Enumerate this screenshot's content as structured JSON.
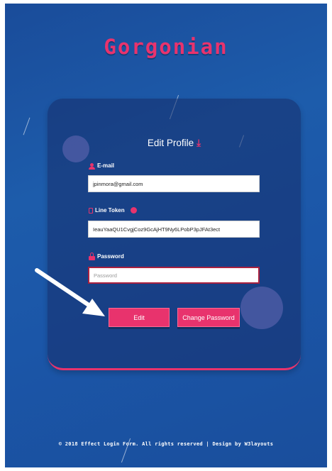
{
  "brand": {
    "title": "Gorgonian"
  },
  "form": {
    "title": "Edit Profile",
    "email": {
      "label": "E-mail",
      "value": "jpinmora@gmail.com"
    },
    "line_token": {
      "label": "Line Token",
      "value": "IeauYaaQU1CvgjCoz9GcAjHT9Ny6LPobP3pJFAt3ect"
    },
    "password": {
      "label": "Password",
      "value": "",
      "placeholder": "Password"
    },
    "edit_label": "Edit",
    "change_password_label": "Change Password"
  },
  "footer": {
    "text": "© 2018 Effect Login Form. All rights reserved | Design by W3layouts"
  },
  "colors": {
    "accent": "#e8336d",
    "background": "#1c55a6",
    "card": "#1a3a7a"
  },
  "icons": [
    "user-icon",
    "document-icon",
    "info-icon",
    "lock-icon",
    "arrow-down-icon",
    "pointer-arrow-icon"
  ]
}
